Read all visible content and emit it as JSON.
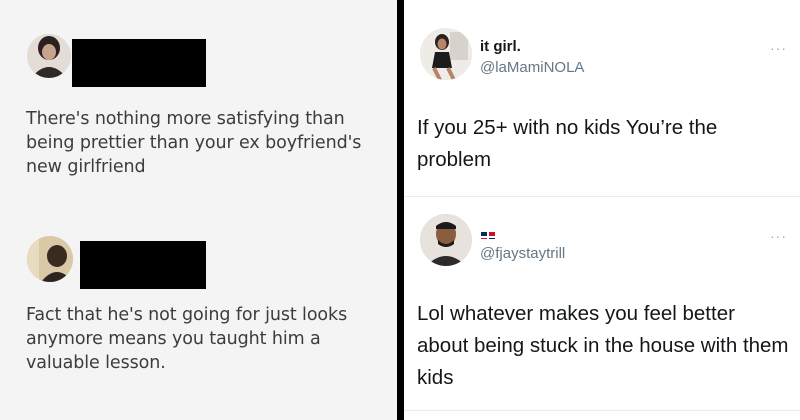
{
  "left_panel": {
    "comments": [
      {
        "text": "There's nothing more satisfying than being prettier than your ex boyfriend's new girlfriend"
      },
      {
        "text": "Fact that he's not going for just looks anymore means you taught him a valuable lesson."
      }
    ]
  },
  "right_panel": {
    "tweets": [
      {
        "display_name": "it girl.",
        "handle": "@laMamiNOLA",
        "text": "If you 25+ with no kids You’re the problem",
        "more_icon": "more-dots-icon"
      },
      {
        "display_name": "",
        "handle": "@fjaystaytrill",
        "text": "Lol whatever makes you feel better about being stuck in the house with them kids",
        "flag_icon": "dominican-flag-icon",
        "more_icon": "more-dots-icon"
      }
    ]
  },
  "colors": {
    "divider": "#000000",
    "left_background": "#f4f4f4",
    "tweet_text": "#14171a",
    "handle": "#657786"
  }
}
